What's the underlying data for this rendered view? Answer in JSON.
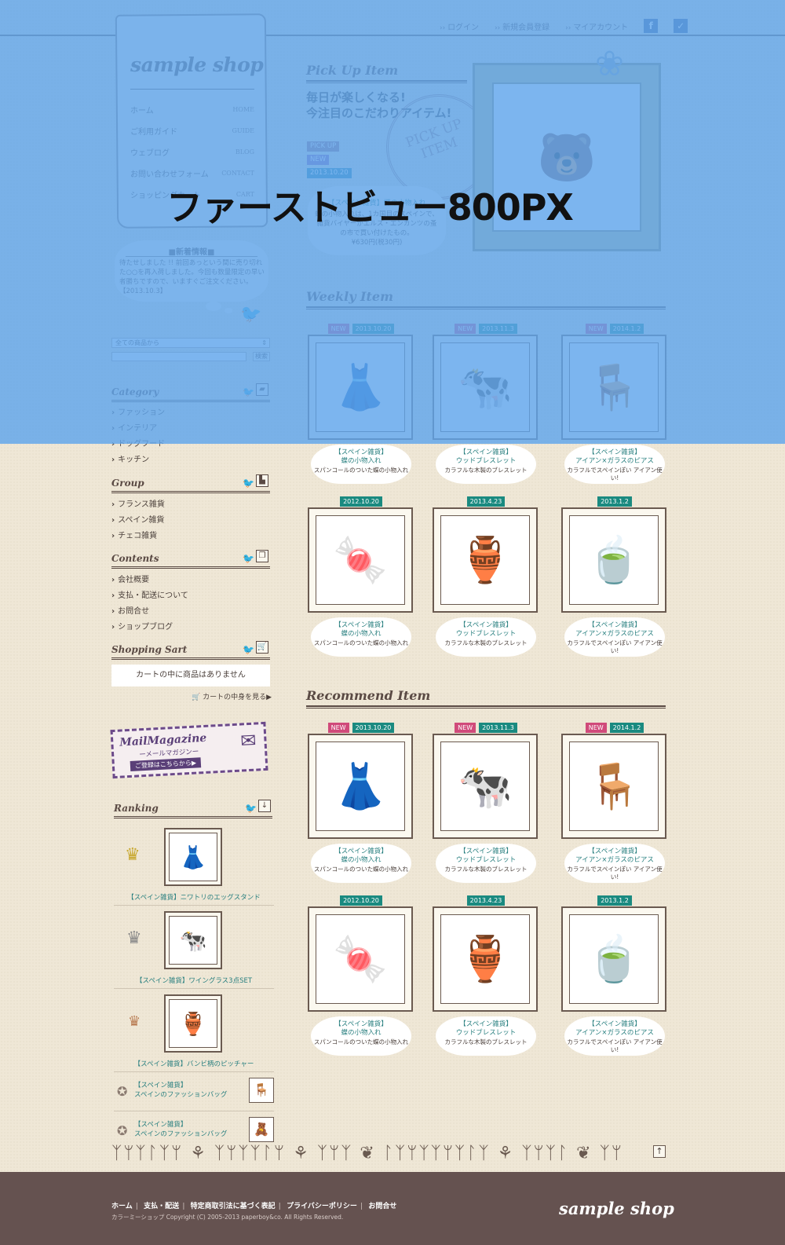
{
  "header": {
    "nav": [
      {
        "label": "ログイン"
      },
      {
        "label": "新規会員登録"
      },
      {
        "label": "マイアカウント"
      }
    ],
    "social": [
      {
        "icon": "facebook-icon",
        "glyph": "f"
      },
      {
        "icon": "twitter-icon",
        "glyph": "🐦"
      }
    ]
  },
  "brand": {
    "logo": "sample shop"
  },
  "global_nav": [
    {
      "label": "ホーム",
      "en": "HOME"
    },
    {
      "label": "ご利用ガイド",
      "en": "GUIDE"
    },
    {
      "label": "ウェブログ",
      "en": "BLOG"
    },
    {
      "label": "お問い合わせフォーム",
      "en": "CONTACT"
    },
    {
      "label": "ショッピングカート",
      "en": "CART"
    }
  ],
  "news": {
    "title": "■新着情報■",
    "body": "待たせしました !! 前回あっという間に売り切れた○○を再入荷しました。今回も数量限定の早い者勝ちですので、いますぐご注文ください。【2013.10.3】"
  },
  "search": {
    "select_value": "全ての商品から",
    "input_value": "",
    "button_label": "検索"
  },
  "sidebar": {
    "category": {
      "title": "Category",
      "items": [
        "ファッション",
        "インテリア",
        "ドッグフード",
        "キッチン"
      ]
    },
    "group": {
      "title": "Group",
      "items": [
        "フランス雑貨",
        "スペイン雑貨",
        "チェコ雑貨"
      ]
    },
    "contents": {
      "title": "Contents",
      "items": [
        "会社概要",
        "支払・配送について",
        "お問合せ",
        "ショップブログ"
      ]
    },
    "cart": {
      "title": "Shopping Sart",
      "empty_message": "カートの中に商品はありません",
      "view_link": "カートの中身を見る▶"
    },
    "mail_magazine": {
      "title": "MailMagazine",
      "subtitle": "ーメールマガジンー",
      "button": "ご登録はこちらから▶"
    },
    "ranking": {
      "title": "Ranking",
      "top": [
        {
          "rank": 1,
          "name": "【スペイン雑貨】ニワトリのエッグスタンド",
          "image": "dress-form"
        },
        {
          "rank": 2,
          "name": "【スペイン雑貨】ワイングラス3点SET",
          "image": "cow-figurines"
        },
        {
          "rank": 3,
          "name": "【スペイン雑貨】バンビ柄のピッチャー",
          "image": "pitcher"
        }
      ],
      "others": [
        {
          "line1": "【スペイン雑貨】",
          "line2": "スペインのファッションバッグ",
          "image": "chair"
        },
        {
          "line1": "【スペイン雑貨】",
          "line2": "スペインのファッションバッグ",
          "image": "door-stops"
        }
      ]
    }
  },
  "pickup": {
    "title": "Pick Up Item",
    "catch1": "毎日が楽しくなる!",
    "catch2": "今注目のこだわりアイテム!",
    "tags": [
      "PICK UP",
      "NEW",
      "2013.10.20"
    ],
    "name": "【スペイン雑貨】蝶の小物入れ",
    "desc1": "蝶の小物入れは、1カ国目のスペインで、",
    "desc2": "雑貨バイヤーがエルス・エンカンツの蚤",
    "desc3": "の市で買い付けたもの。",
    "price": "¥630円(税30円)",
    "stamp1": "PICK UP",
    "stamp2": "ITEM"
  },
  "weekly": {
    "title": "Weekly Item",
    "items": [
      {
        "new": "NEW",
        "date": "2013.10.20",
        "image": "dress-form",
        "cat": "【スペイン雑貨】",
        "name": "蝶の小物入れ",
        "desc": "スパンコールのついた蝶の小物入れ"
      },
      {
        "new": "NEW",
        "date": "2013.11.3",
        "image": "cow-figurines",
        "cat": "【スペイン雑貨】",
        "name": "ウッドブレスレット",
        "desc": "カラフルな木製のブレスレット"
      },
      {
        "new": "NEW",
        "date": "2014.1.2",
        "image": "chair",
        "cat": "【スペイン雑貨】",
        "name": "アイアン×ガラスのピアス",
        "desc": "カラフルでスペインぽい アイアン使い!"
      },
      {
        "new": "",
        "date": "2012.10.20",
        "image": "jelly-beans",
        "cat": "【スペイン雑貨】",
        "name": "蝶の小物入れ",
        "desc": "スパンコールのついた蝶の小物入れ"
      },
      {
        "new": "",
        "date": "2013.4.23",
        "image": "pitcher",
        "cat": "【スペイン雑貨】",
        "name": "ウッドブレスレット",
        "desc": "カラフルな木製のブレスレット"
      },
      {
        "new": "",
        "date": "2013.1.2",
        "image": "bowls",
        "cat": "【スペイン雑貨】",
        "name": "アイアン×ガラスのピアス",
        "desc": "カラフルでスペインぽい アイアン使い!"
      }
    ]
  },
  "recommend": {
    "title": "Recommend Item",
    "items": [
      {
        "new": "NEW",
        "date": "2013.10.20",
        "image": "dress-form",
        "cat": "【スペイン雑貨】",
        "name": "蝶の小物入れ",
        "desc": "スパンコールのついた蝶の小物入れ"
      },
      {
        "new": "NEW",
        "date": "2013.11.3",
        "image": "cow-figurines",
        "cat": "【スペイン雑貨】",
        "name": "ウッドブレスレット",
        "desc": "カラフルな木製のブレスレット"
      },
      {
        "new": "NEW",
        "date": "2014.1.2",
        "image": "chair",
        "cat": "【スペイン雑貨】",
        "name": "アイアン×ガラスのピアス",
        "desc": "カラフルでスペインぽい アイアン使い!"
      },
      {
        "new": "",
        "date": "2012.10.20",
        "image": "jelly-beans",
        "cat": "【スペイン雑貨】",
        "name": "蝶の小物入れ",
        "desc": "スパンコールのついた蝶の小物入れ"
      },
      {
        "new": "",
        "date": "2013.4.23",
        "image": "pitcher",
        "cat": "【スペイン雑貨】",
        "name": "ウッドブレスレット",
        "desc": "カラフルな木製のブレスレット"
      },
      {
        "new": "",
        "date": "2013.1.2",
        "image": "bowls",
        "cat": "【スペイン雑貨】",
        "name": "アイアン×ガラスのピアス",
        "desc": "カラフルでスペインぽい アイアン使い!"
      }
    ]
  },
  "footer": {
    "links": [
      "ホーム",
      "支払・配送",
      "特定商取引法に基づく表記",
      "プライバシーポリシー",
      "お問合せ"
    ],
    "copyright": "カラーミーショップ Copyright (C) 2005-2013 paperboy&co. All Rights Reserved.",
    "logo": "sample shop"
  },
  "overlay": {
    "label": "ファーストビュー800PX",
    "color": "#5fa5eb"
  },
  "colors": {
    "teal": "#1a8a80",
    "pink": "#d04a7a",
    "footer_bg": "#655250",
    "purple": "#5a3f78"
  }
}
